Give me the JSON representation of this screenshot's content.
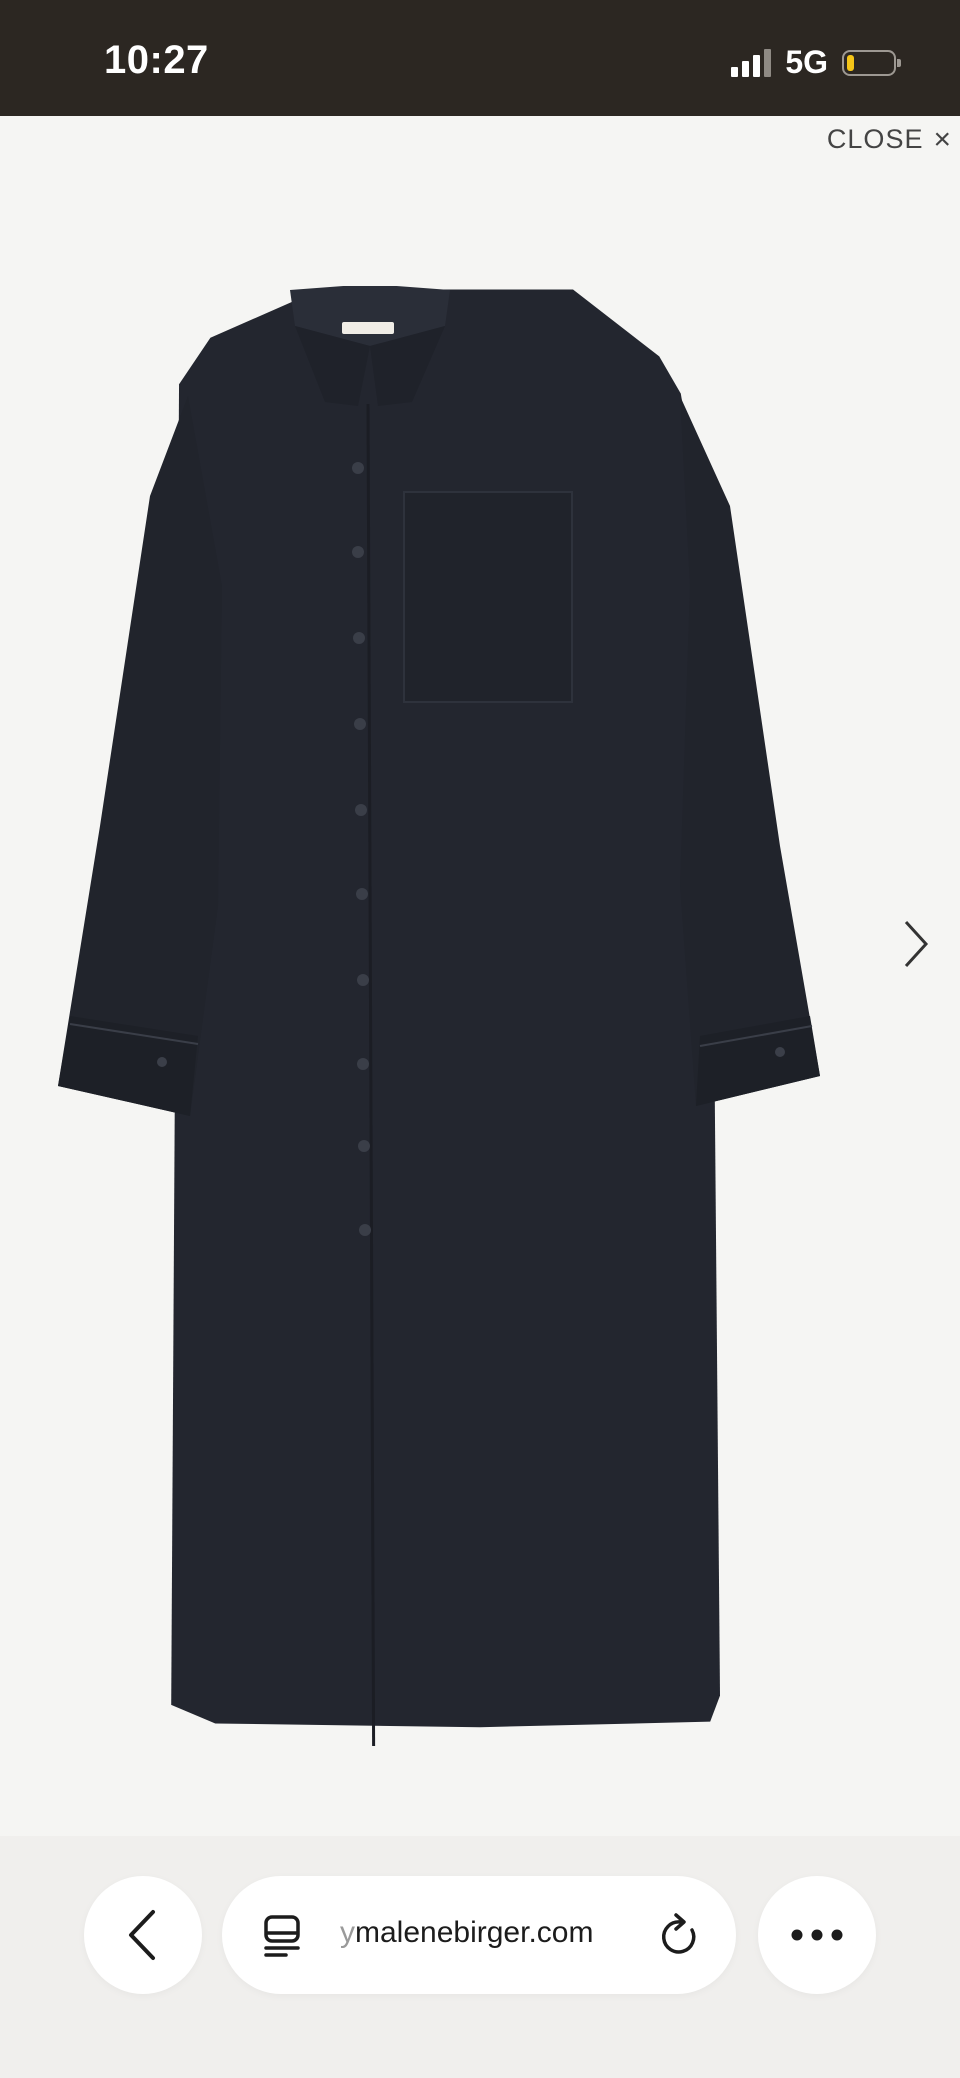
{
  "status_bar": {
    "time": "10:27",
    "network": "5G",
    "signal_bars": 4,
    "signal_active_bars": 3,
    "battery_level_percent": 15,
    "battery_fill_color": "#f5c518"
  },
  "viewer": {
    "close_label": "CLOSE",
    "close_icon": "×",
    "next_icon": "chevron-right-icon",
    "product_image": "black long-sleeve shirt dress with front pocket and button placket"
  },
  "browser": {
    "url_prefix": "y",
    "url_rest": "malenebirger.com",
    "back_icon": "chevron-left-icon",
    "tabs_icon": "tabs-icon",
    "reload_icon": "reload-icon",
    "more_icon": "more-icon"
  },
  "colors": {
    "status_bar_bg": "#2c2722",
    "page_bg": "#f5f5f3",
    "garment": "#23262f"
  }
}
